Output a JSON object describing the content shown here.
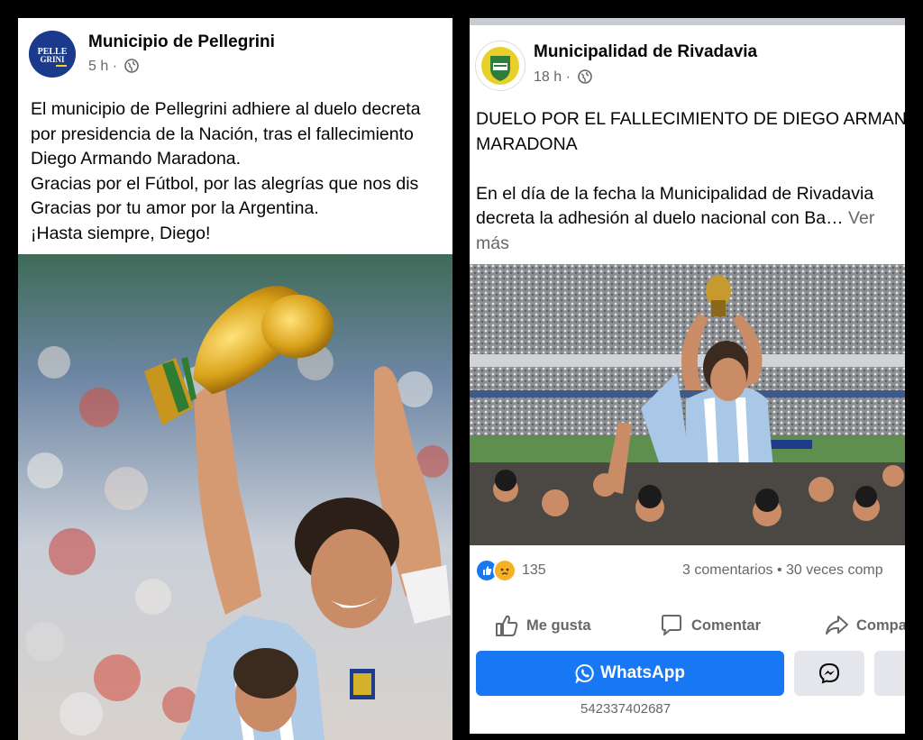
{
  "left_post": {
    "page_name": "Municipio de Pellegrini",
    "logo_text": "PELLE GRINI",
    "time": "5 h",
    "separator": "·",
    "text_lines": [
      "El municipio de Pellegrini adhiere al duelo decreta",
      "por presidencia de la Nación, tras el fallecimiento",
      "Diego Armando Maradona.",
      "Gracias por el Fútbol, por las alegrías que nos dis",
      "Gracias por tu amor por la Argentina.",
      "¡Hasta siempre, Diego!"
    ],
    "photo_icon": "maradona-world-cup-trophy-photo"
  },
  "right_post": {
    "page_name": "Municipalidad de Rivadavia",
    "time": "18 h",
    "separator": "·",
    "text_lines": [
      "DUELO POR EL FALLECIMIENTO DE DIEGO ARMAN",
      "MARADONA",
      "",
      "En el día de la fecha la Municipalidad de Rivadavia",
      "decreta la adhesión al duelo nacional con Ba…"
    ],
    "see_more_1": "Ver",
    "see_more_2": "más",
    "photo_icon": "maradona-stadium-celebration-photo",
    "reaction_count": "135",
    "comments_shares": "3 comentarios • 30 veces comp",
    "like_label": "Me gusta",
    "comment_label": "Comentar",
    "share_label": "Compa",
    "whatsapp_label": "WhatsApp",
    "phone": "542337402687"
  },
  "colors": {
    "facebook_blue": "#1877f2",
    "secondary_text": "#65676b",
    "button_grey": "#e4e6eb",
    "background": "#000000"
  }
}
